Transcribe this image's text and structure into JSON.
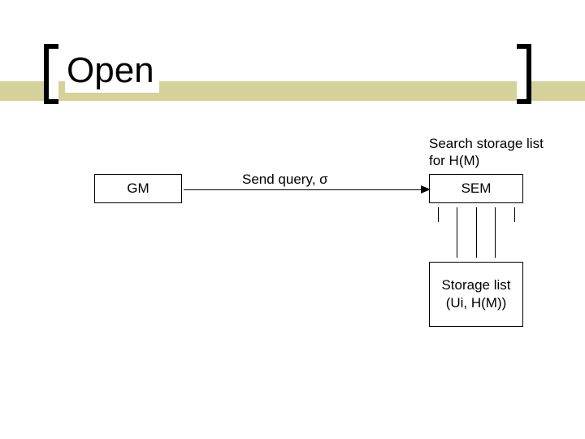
{
  "title": "Open",
  "boxes": {
    "gm": "GM",
    "sem": "SEM",
    "storage_l1": "Storage list",
    "storage_l2": "(Ui, H(M))"
  },
  "annotations": {
    "search_l1": "Search storage list",
    "search_l2": "for H(M)",
    "send_query": "Send query, σ"
  }
}
